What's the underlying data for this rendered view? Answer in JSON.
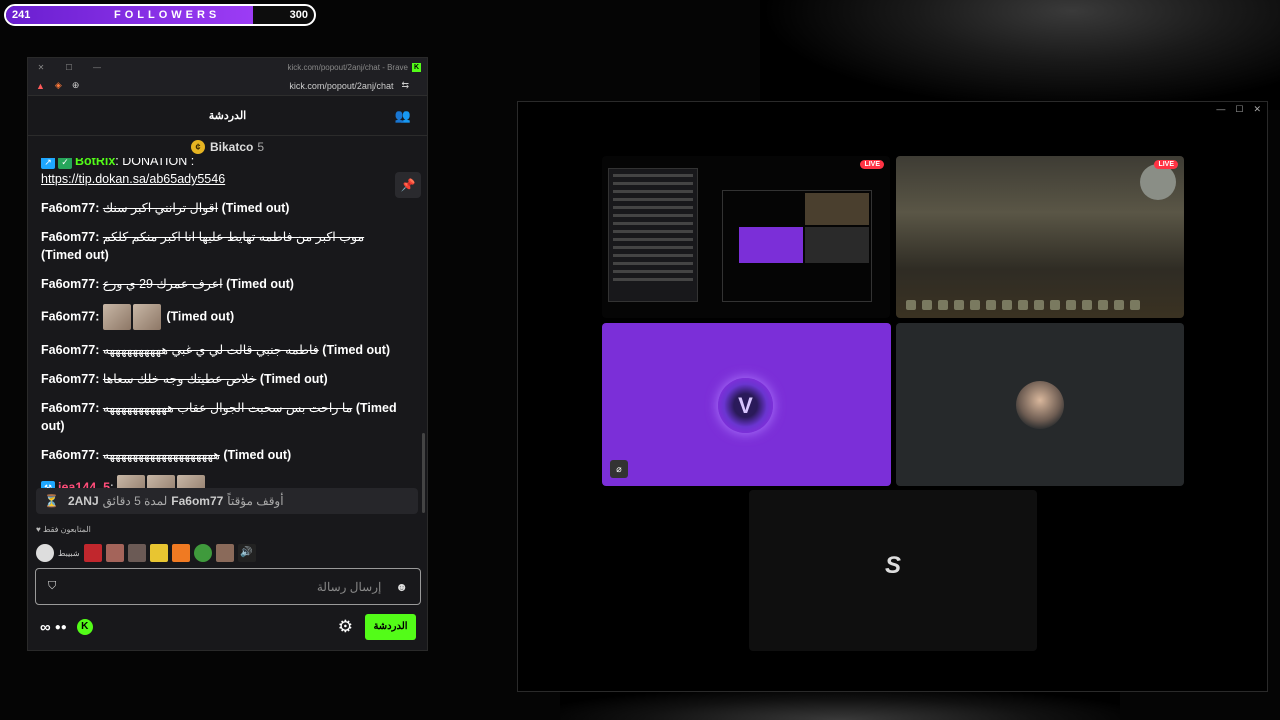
{
  "follower_goal": {
    "current": "241",
    "label": "FOLLOWERS",
    "target": "300",
    "progress_percent": 80.3
  },
  "browser": {
    "title_url": "kick.com/popout/2anj/chat - Brave",
    "address": "kick.com/popout/2anj/chat"
  },
  "chat": {
    "header_title": "الدردشة",
    "pinned_user": "Bikatco",
    "pinned_count": "5",
    "messages": [
      {
        "user": "BotRix",
        "text": "DONATION :",
        "link": "https://tip.dokan.sa/ab65ady5546"
      },
      {
        "user": "Fa6om77:",
        "deleted": "اقوال ترانني اكبر سنك",
        "status": "(Timed out)"
      },
      {
        "user": "Fa6om77:",
        "deleted": "موب اكبر من فاطمه تهايط عليها انا اكبر منكم كلكم",
        "status": "(Timed out)"
      },
      {
        "user": "Fa6om77:",
        "deleted": "اعرف عمرك 29 ي ورع",
        "status": "(Timed out)"
      },
      {
        "user": "Fa6om77:",
        "deleted": "",
        "status": "(Timed out)"
      },
      {
        "user": "Fa6om77:",
        "deleted": "فاطمه جنبي قالت لي ي غبي ههههههههههه",
        "status": "(Timed out)"
      },
      {
        "user": "Fa6om77:",
        "deleted": "خلاص عطيتك وجه خلك سعاها",
        "status": "(Timed out)"
      },
      {
        "user": "Fa6om77:",
        "deleted": "ما راحت بس سحبت الجوال عقاب هههههههههههه",
        "status": "(Timed out)"
      },
      {
        "user": "Fa6om77:",
        "deleted": "هههههههههههههههههههه",
        "status": "(Timed out)"
      },
      {
        "user": "jea144_5",
        "text": ""
      }
    ],
    "timeout_notice": {
      "moderator": "2ANJ",
      "middle": "لمدة 5 دقائق",
      "user": "Fa6om77",
      "action": "أوقف مؤقتاً"
    },
    "followers_only": "المتابعون فقط",
    "emote_label": "شبيبط",
    "input_placeholder": "إرسال رسالة",
    "chat_button": "الدردشة"
  },
  "stream": {
    "live_badge": "LIVE"
  },
  "colors": {
    "kick_green": "#53fc18",
    "purple": "#7b2fd8",
    "live_red": "#ff3344"
  }
}
